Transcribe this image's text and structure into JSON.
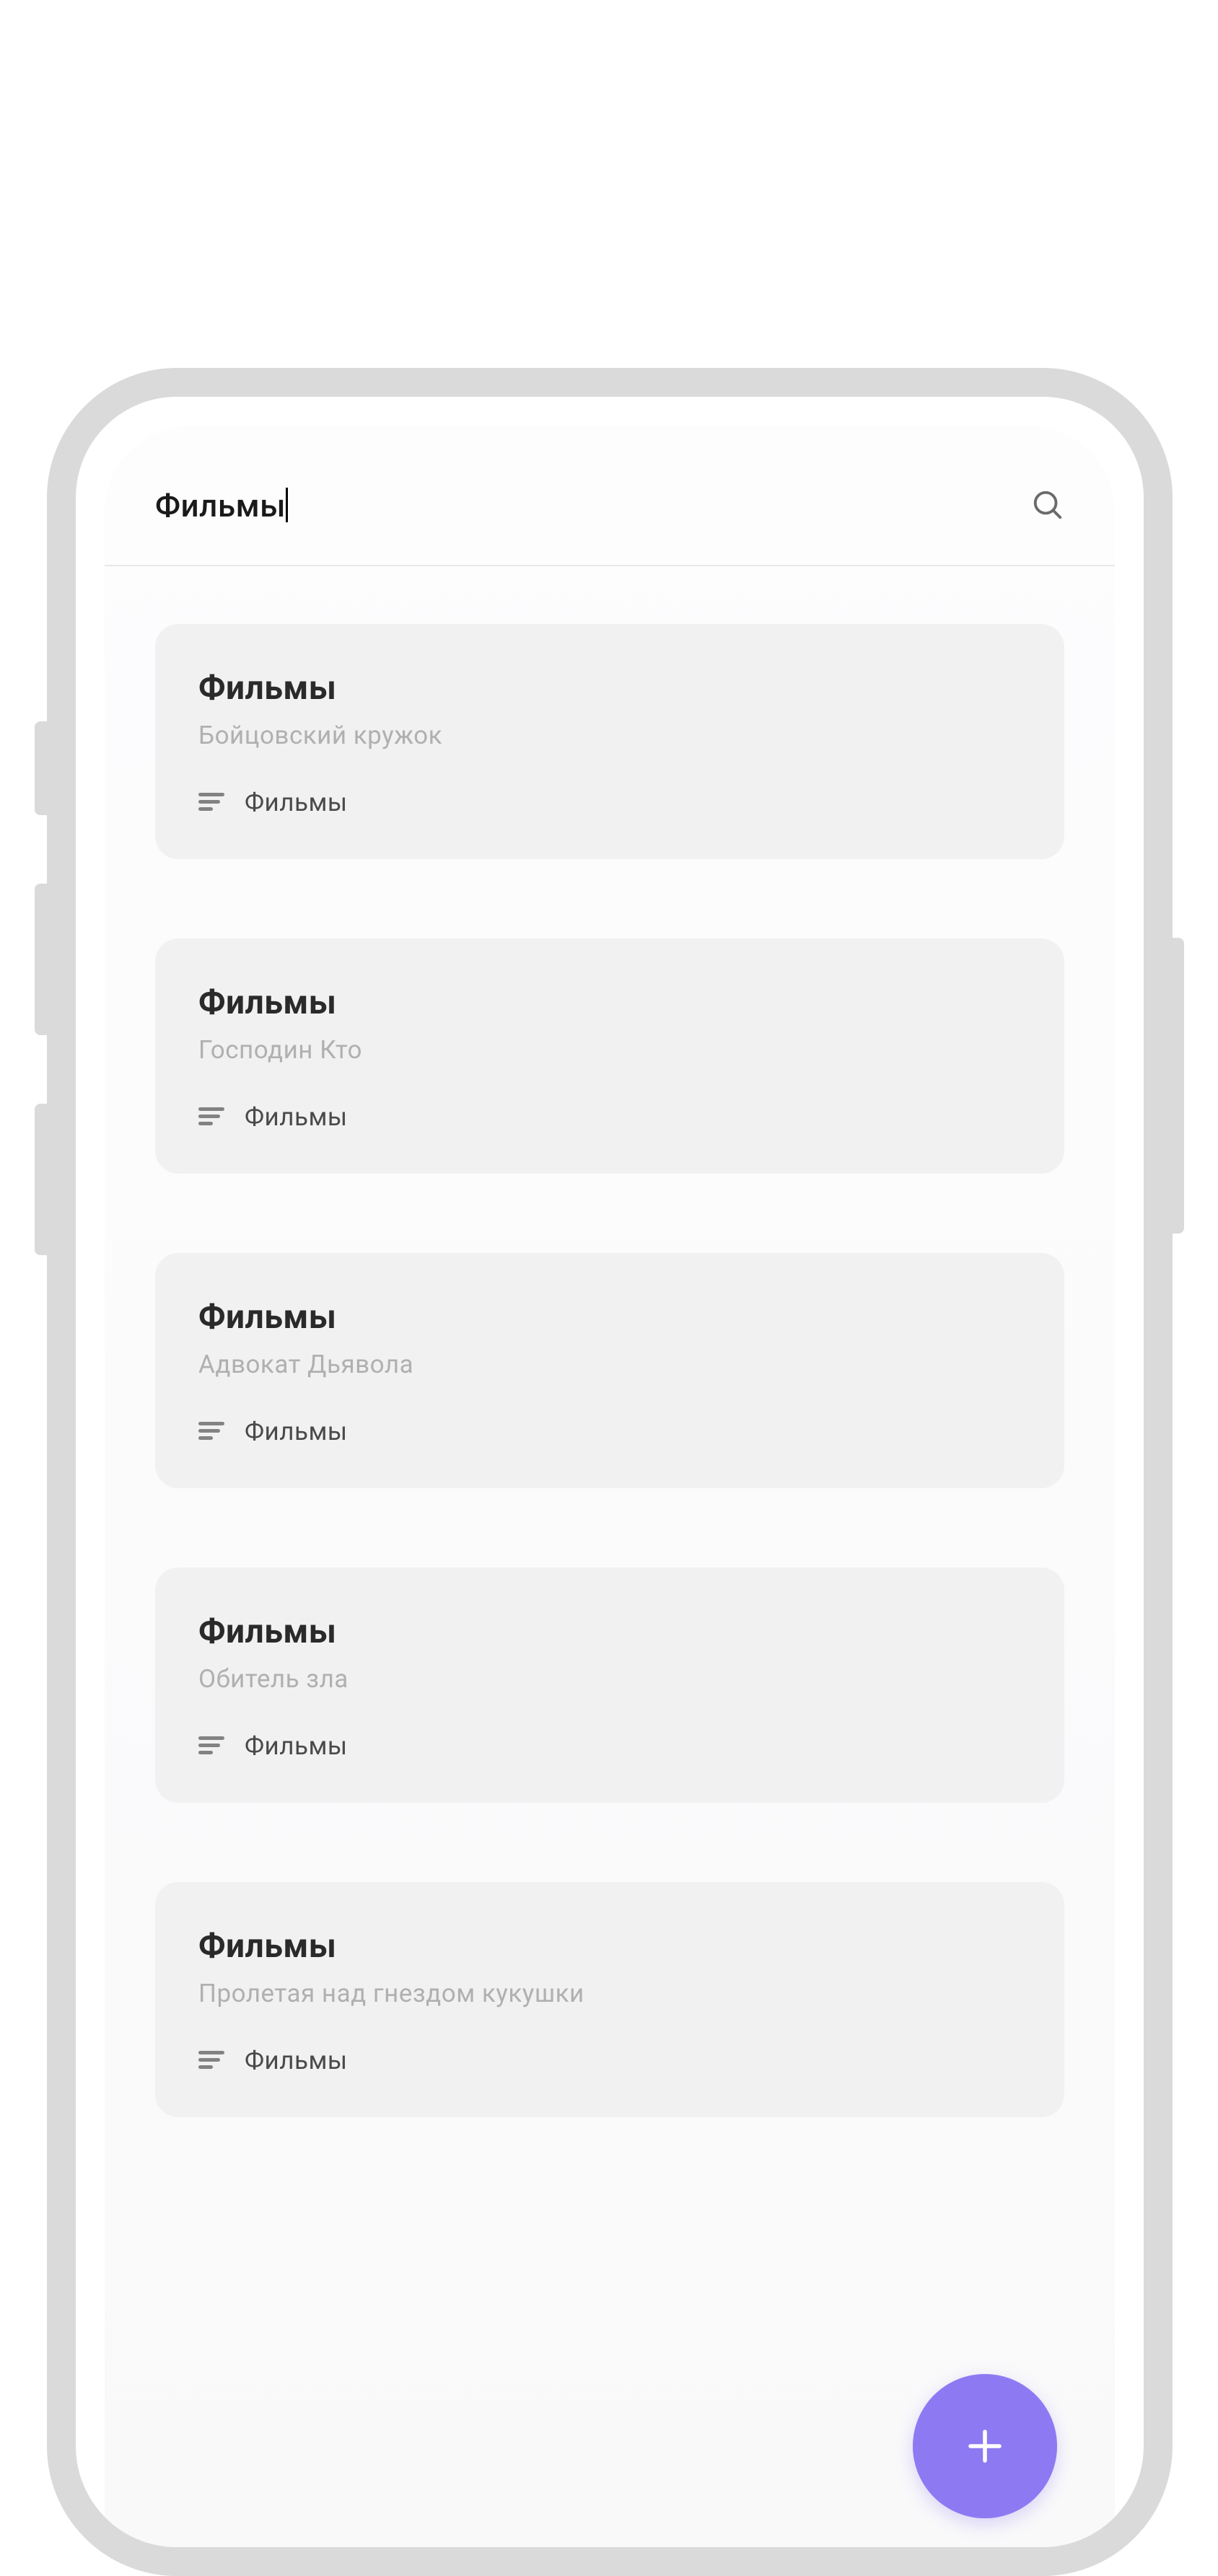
{
  "header": {
    "title": "Фильмы"
  },
  "cards": [
    {
      "title": "Фильмы",
      "subtitle": "Бойцовский кружок",
      "tag": "Фильмы"
    },
    {
      "title": "Фильмы",
      "subtitle": "Господин Кто",
      "tag": "Фильмы"
    },
    {
      "title": "Фильмы",
      "subtitle": "Адвокат Дьявола",
      "tag": "Фильмы"
    },
    {
      "title": "Фильмы",
      "subtitle": "Обитель зла",
      "tag": "Фильмы"
    },
    {
      "title": "Фильмы",
      "subtitle": "Пролетая над гнездом кукушки",
      "tag": "Фильмы"
    }
  ],
  "colors": {
    "fab": "#8d7af2",
    "card_bg": "#f1f1f2",
    "text_muted": "#b0b0b0"
  }
}
